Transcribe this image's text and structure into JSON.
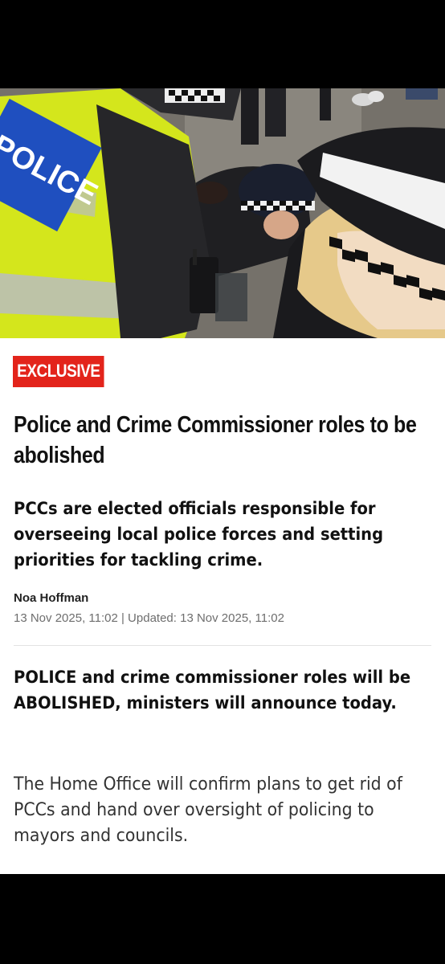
{
  "hero_image": {
    "alt_subject": "police officers in hi-vis jackets kneeling over a person",
    "vest_print": "POLICE",
    "colors": {
      "hi_vis": "#d9ec1f",
      "vest_panel": "#1f4fbf",
      "uniform": "#1c1c1e",
      "ground": "#6f6b64",
      "hair": "#e6c98a"
    }
  },
  "article": {
    "badge": "EXCLUSIVE",
    "badge_color": "#e3241b",
    "headline": "Police and Crime Commissioner roles to be abolished",
    "standfirst": "PCCs are elected officials responsible for overseeing local police forces and setting priorities for tackling crime.",
    "author": "Noa Hoffman",
    "dateline": "13 Nov 2025, 11:02 | Updated: 13 Nov 2025, 11:02",
    "lede": "POLICE and crime commissioner roles will be ABOLISHED, ministers will announce today.",
    "body": "The Home Office will confirm plans to get rid of PCCs and hand over oversight of policing to mayors and councils."
  }
}
